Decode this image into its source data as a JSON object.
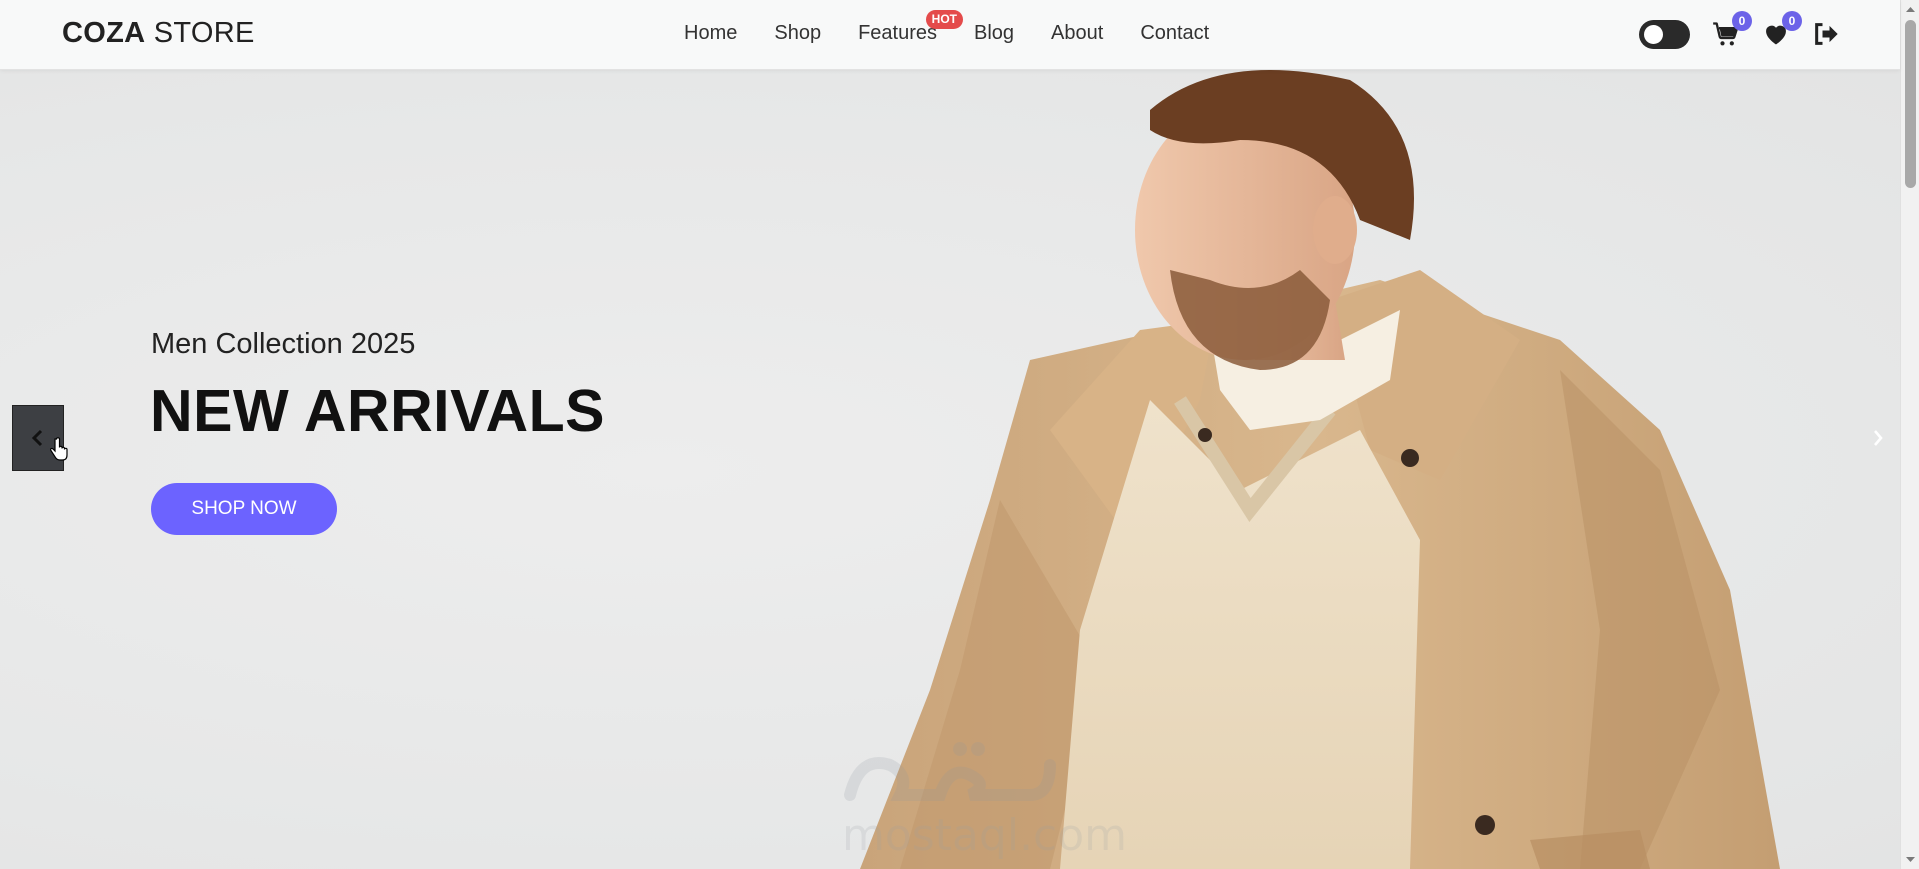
{
  "brand": {
    "bold": "COZA",
    "light": " STORE"
  },
  "nav": {
    "items": [
      {
        "label": "Home"
      },
      {
        "label": "Shop"
      },
      {
        "label": "Features",
        "badge": "HOT"
      },
      {
        "label": "Blog"
      },
      {
        "label": "About"
      },
      {
        "label": "Contact"
      }
    ]
  },
  "header_actions": {
    "theme_toggle": "dark-mode-toggle",
    "cart_count": "0",
    "wishlist_count": "0",
    "icons": [
      "cart-icon",
      "heart-icon",
      "logout-icon"
    ]
  },
  "hero": {
    "subtitle": "Men Collection 2025",
    "title": "NEW ARRIVALS",
    "cta_label": "SHOP NOW",
    "prev_icon": "chevron-left-icon",
    "next_icon": "chevron-right-icon"
  },
  "watermark": {
    "text": "mostaql.com"
  },
  "colors": {
    "accent": "#6c63ff",
    "badge_hot": "#e44b4b",
    "count_badge": "#6c63e8",
    "header_bg": "#f8f9f9",
    "hero_bg": "#e9eaea"
  }
}
